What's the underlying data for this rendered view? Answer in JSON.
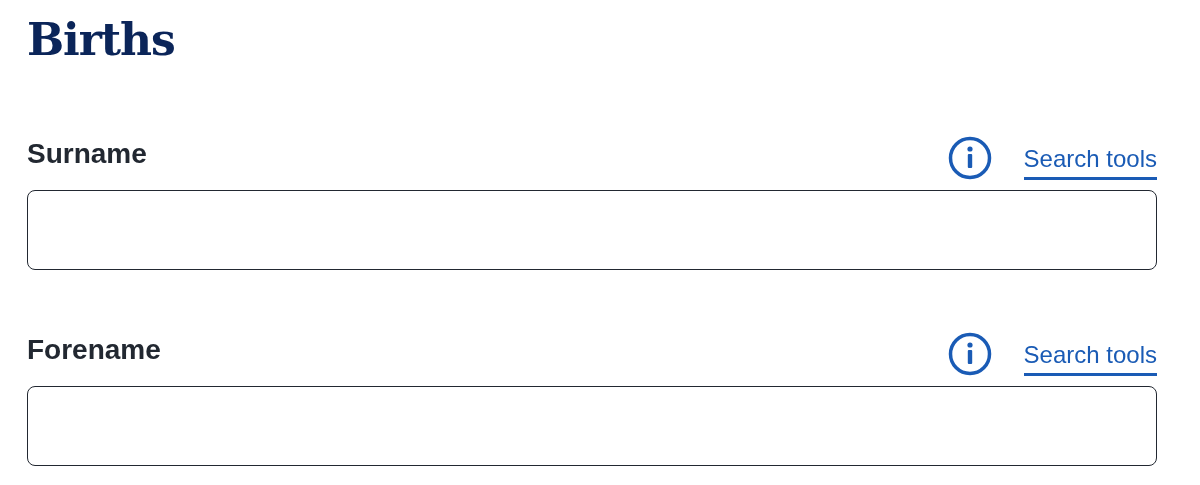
{
  "heading": "Births",
  "fields": [
    {
      "label": "Surname",
      "link": "Search tools"
    },
    {
      "label": "Forename",
      "link": "Search tools"
    }
  ]
}
